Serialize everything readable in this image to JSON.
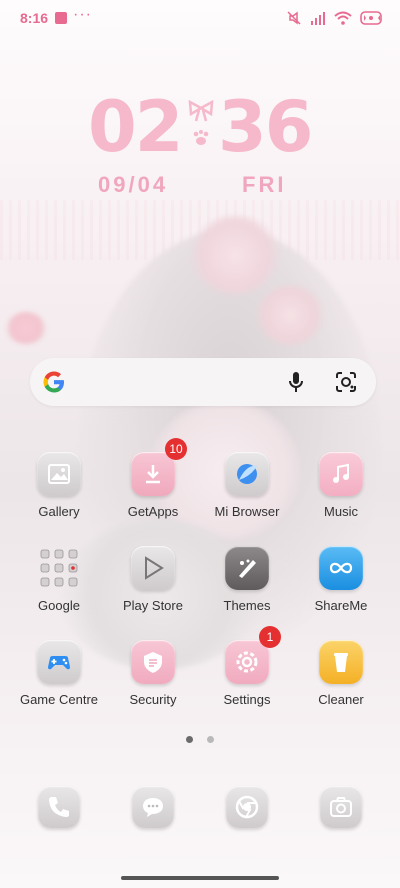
{
  "status": {
    "time": "8:16"
  },
  "clock": {
    "hours": "02",
    "minutes": "36",
    "date": "09/04",
    "weekday": "FRI"
  },
  "search": {
    "icons": [
      "google-logo",
      "mic-icon",
      "lens-icon"
    ]
  },
  "apps": [
    {
      "label": "Gallery"
    },
    {
      "label": "GetApps",
      "badge": "10"
    },
    {
      "label": "Mi Browser"
    },
    {
      "label": "Music"
    },
    {
      "label": "Google"
    },
    {
      "label": "Play Store"
    },
    {
      "label": "Themes"
    },
    {
      "label": "ShareMe"
    },
    {
      "label": "Game Centre"
    },
    {
      "label": "Security"
    },
    {
      "label": "Settings",
      "badge": "1"
    },
    {
      "label": "Cleaner"
    }
  ],
  "dock": [
    "phone-icon",
    "messages-icon",
    "chrome-icon",
    "camera-icon"
  ],
  "pager": {
    "pages": 2,
    "active": 1
  },
  "colors": {
    "accent": "#e86a90",
    "clock": "#f6b9cb",
    "badge": "#e43030"
  }
}
